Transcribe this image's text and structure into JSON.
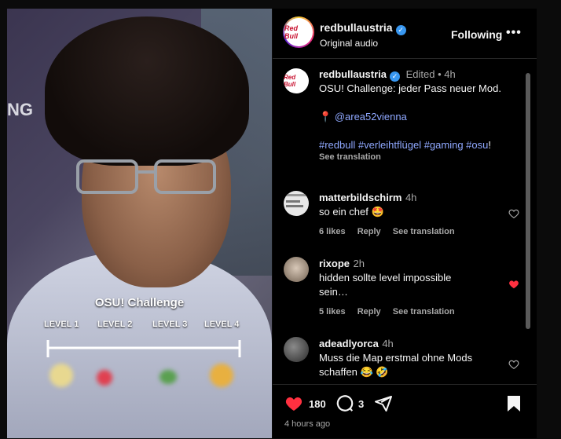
{
  "video": {
    "overlay_title": "OSU! Challenge",
    "levels": [
      "LEVEL 1",
      "LEVEL 2",
      "LEVEL 3",
      "LEVEL 4"
    ],
    "bg_text": "NG"
  },
  "header": {
    "username": "redbullaustria",
    "subtitle": "Original audio",
    "follow_label": "Following",
    "more_label": "•••",
    "avatar_text": "Red Bull"
  },
  "caption": {
    "username": "redbullaustria",
    "edited": "Edited",
    "dot": "•",
    "time": "4h",
    "text": "OSU! Challenge: jeder Pass neuer Mod.",
    "location_pin": "📍",
    "mention": "@area52vienna",
    "hashtags": "#redbull #verleihtflügel #gaming #osu",
    "hashtags_end": "!",
    "see_translation": "See translation"
  },
  "comments": [
    {
      "username": "matterbildschirm",
      "time": "4h",
      "text": "so ein chef 🤩",
      "likes": "6 likes",
      "reply": "Reply",
      "see_translation": "See translation",
      "liked": false
    },
    {
      "username": "rixope",
      "time": "2h",
      "text": "hidden sollte level impossible sein…",
      "likes": "5 likes",
      "reply": "Reply",
      "see_translation": "See translation",
      "liked": true
    },
    {
      "username": "adeadlyorca",
      "time": "4h",
      "text": "Muss die Map erstmal ohne Mods schaffen 😂 🤣",
      "liked": false
    }
  ],
  "actions": {
    "like_count": "180",
    "comment_count": "3",
    "time_ago": "4 hours ago"
  },
  "colors": {
    "heart_red": "#ff3040",
    "link_blue": "#8fa8ff",
    "verified_blue": "#3897f0"
  }
}
